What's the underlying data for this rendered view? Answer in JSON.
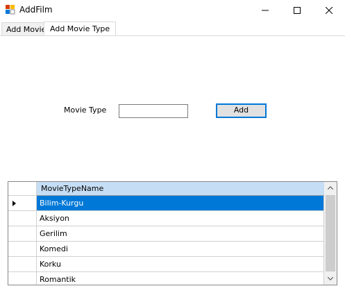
{
  "window": {
    "title": "AddFilm"
  },
  "tabs": [
    {
      "label": "Add Movie"
    },
    {
      "label": "Add  Movie Type"
    }
  ],
  "form": {
    "label": "Movie Type",
    "input_value": "",
    "button_label": "Add"
  },
  "grid": {
    "column_header": "MovieTypeName",
    "rows": [
      "Bilim-Kurgu",
      "Aksiyon",
      "Gerilim",
      "Komedi",
      "Korku",
      "Romantik"
    ],
    "selected_index": 0
  },
  "colors": {
    "selection": "#0078d7",
    "header": "#c6def5"
  },
  "icons": [
    "app-icon",
    "minimize-icon",
    "maximize-icon",
    "close-icon",
    "scroll-up-icon",
    "scroll-down-icon",
    "row-indicator-icon"
  ]
}
